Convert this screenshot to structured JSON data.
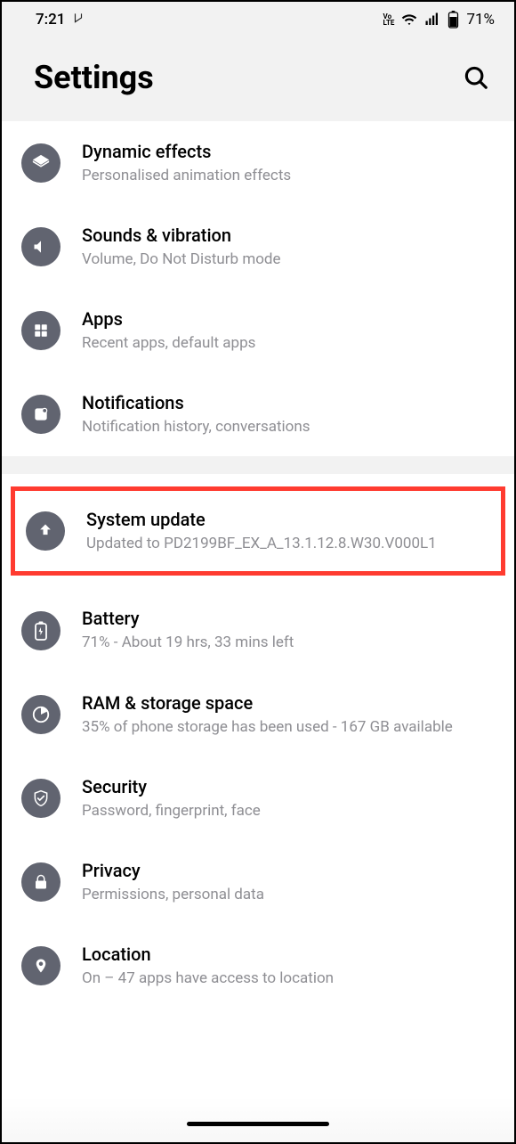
{
  "statusbar": {
    "time": "7:21",
    "volte": "VoLTE",
    "battery": "71%"
  },
  "header": {
    "title": "Settings"
  },
  "section1": [
    {
      "id": "dynamic-effects",
      "title": "Dynamic effects",
      "subtitle": "Personalised animation effects",
      "icon": "layers"
    },
    {
      "id": "sounds",
      "title": "Sounds & vibration",
      "subtitle": "Volume, Do Not Disturb mode",
      "icon": "volume"
    },
    {
      "id": "apps",
      "title": "Apps",
      "subtitle": "Recent apps, default apps",
      "icon": "grid"
    },
    {
      "id": "notifications",
      "title": "Notifications",
      "subtitle": "Notification history, conversations",
      "icon": "notification"
    }
  ],
  "section2": [
    {
      "id": "system-update",
      "title": "System update",
      "subtitle": "Updated to PD2199BF_EX_A_13.1.12.8.W30.V000L1",
      "icon": "update",
      "highlighted": true
    },
    {
      "id": "battery",
      "title": "Battery",
      "subtitle": "71% - About 19 hrs, 33 mins left",
      "icon": "battery"
    },
    {
      "id": "storage",
      "title": "RAM & storage space",
      "subtitle": "35% of phone storage has been used - 167 GB available",
      "icon": "pie"
    },
    {
      "id": "security",
      "title": "Security",
      "subtitle": "Password, fingerprint, face",
      "icon": "shield"
    },
    {
      "id": "privacy",
      "title": "Privacy",
      "subtitle": "Permissions, personal data",
      "icon": "lock"
    },
    {
      "id": "location",
      "title": "Location",
      "subtitle": "On – 47 apps have access to location",
      "icon": "location"
    }
  ]
}
